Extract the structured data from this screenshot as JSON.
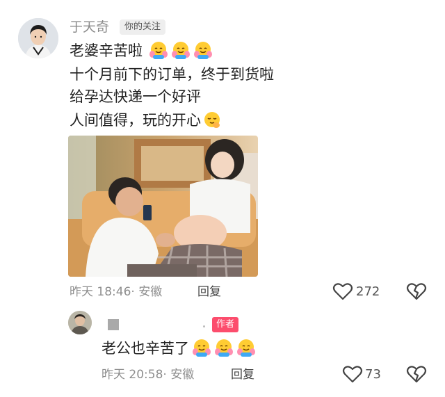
{
  "comment": {
    "username": "于天奇",
    "follow_badge": "你的关注",
    "lines": [
      "老婆辛苦啦",
      "十个月前下的订单，终于到货啦",
      "给孕达快递一个好评",
      "人间值得，玩的开心"
    ],
    "line1_emojis": [
      "hugging-face",
      "hugging-face",
      "hugging-face"
    ],
    "line4_emoji": "relieved-face",
    "time": "昨天 18:46",
    "location": "· 安徽",
    "reply_label": "回复",
    "like_count": "272"
  },
  "reply": {
    "author_badge": "作者",
    "text": "老公也辛苦了",
    "emojis": [
      "hugging-face",
      "hugging-face",
      "hugging-face"
    ],
    "time": "昨天 20:58",
    "location": "· 安徽",
    "reply_label": "回复",
    "like_count": "73"
  },
  "colors": {
    "author_badge_bg": "#fc4d6d",
    "meta_text": "#8e8e8e",
    "username": "#8a8a8a"
  }
}
